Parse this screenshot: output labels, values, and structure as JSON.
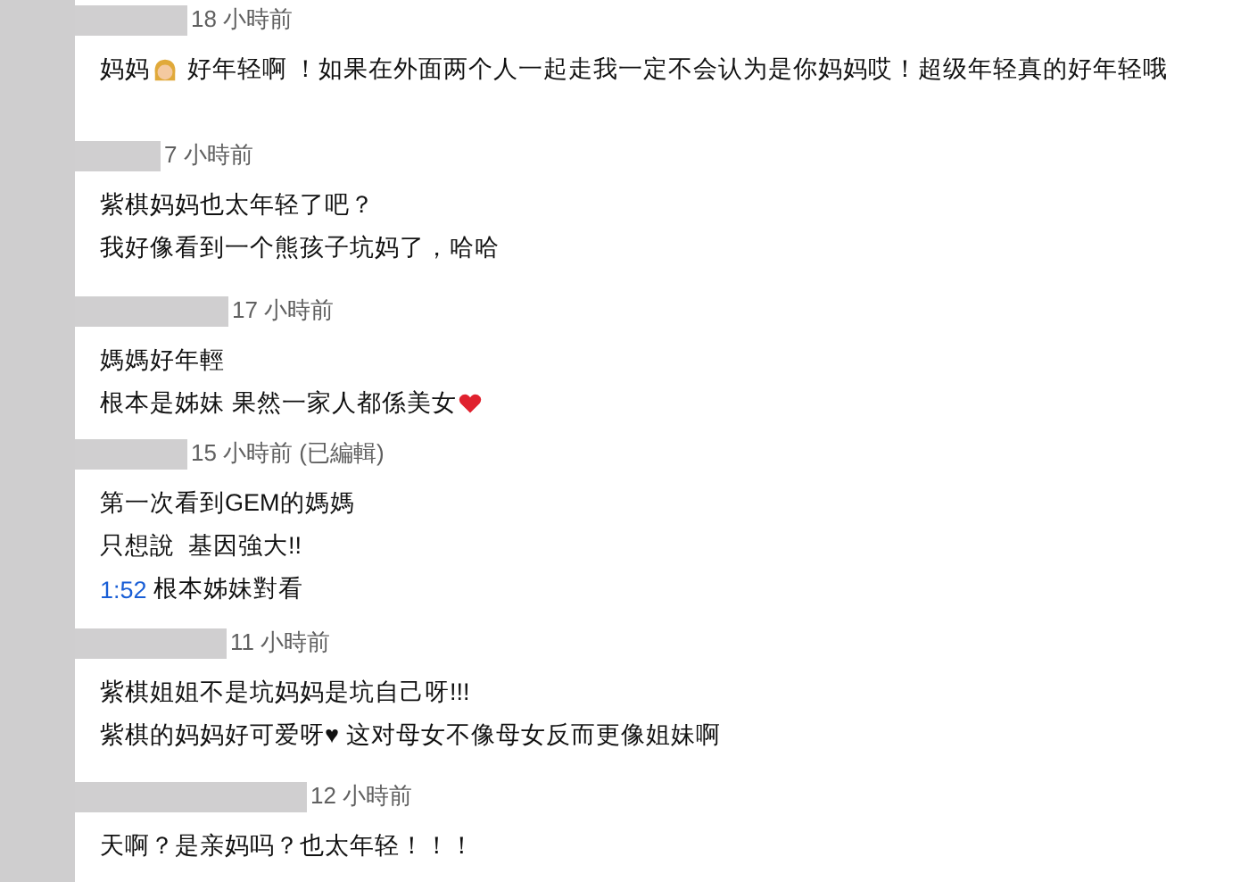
{
  "comments": [
    {
      "time": "18 小時前",
      "lines": [
        [
          {
            "kind": "text",
            "text": "妈妈"
          },
          {
            "kind": "emoji"
          },
          {
            "kind": "text",
            "text": " 好年轻啊 ！如果在外面两个人一起走我一定不会认为是你妈妈哎！超级年轻真的好年轻哦"
          }
        ]
      ]
    },
    {
      "time": "7 小時前",
      "lines": [
        [
          {
            "kind": "text",
            "text": "紫棋妈妈也太年轻了吧？"
          }
        ],
        [
          {
            "kind": "text",
            "text": "我好像看到一个熊孩子坑妈了，哈哈"
          }
        ]
      ]
    },
    {
      "time": "17 小時前",
      "lines": [
        [
          {
            "kind": "text",
            "text": "媽媽好年輕"
          }
        ],
        [
          {
            "kind": "text",
            "text": "根本是姊妹 果然一家人都係美女"
          },
          {
            "kind": "heart"
          }
        ]
      ]
    },
    {
      "time": "15 小時前 (已編輯)",
      "lines": [
        [
          {
            "kind": "text",
            "text": "第一次看到GEM的媽媽"
          }
        ],
        [
          {
            "kind": "text",
            "text": "只想說  基因強大!!"
          }
        ],
        [
          {
            "kind": "link",
            "text": "1:52"
          },
          {
            "kind": "text",
            "text": " 根本姊妹對看"
          }
        ]
      ]
    },
    {
      "time": "11 小時前",
      "lines": [
        [
          {
            "kind": "text",
            "text": "紫棋姐姐不是坑妈妈是坑自己呀!!!"
          }
        ],
        [
          {
            "kind": "text",
            "text": "紫棋的妈妈好可爱呀♥ 这对母女不像母女反而更像姐妹啊"
          }
        ]
      ]
    },
    {
      "time": "12 小時前",
      "lines": [
        [
          {
            "kind": "text",
            "text": "天啊？是亲妈吗？也太年轻！！！"
          }
        ]
      ]
    }
  ]
}
